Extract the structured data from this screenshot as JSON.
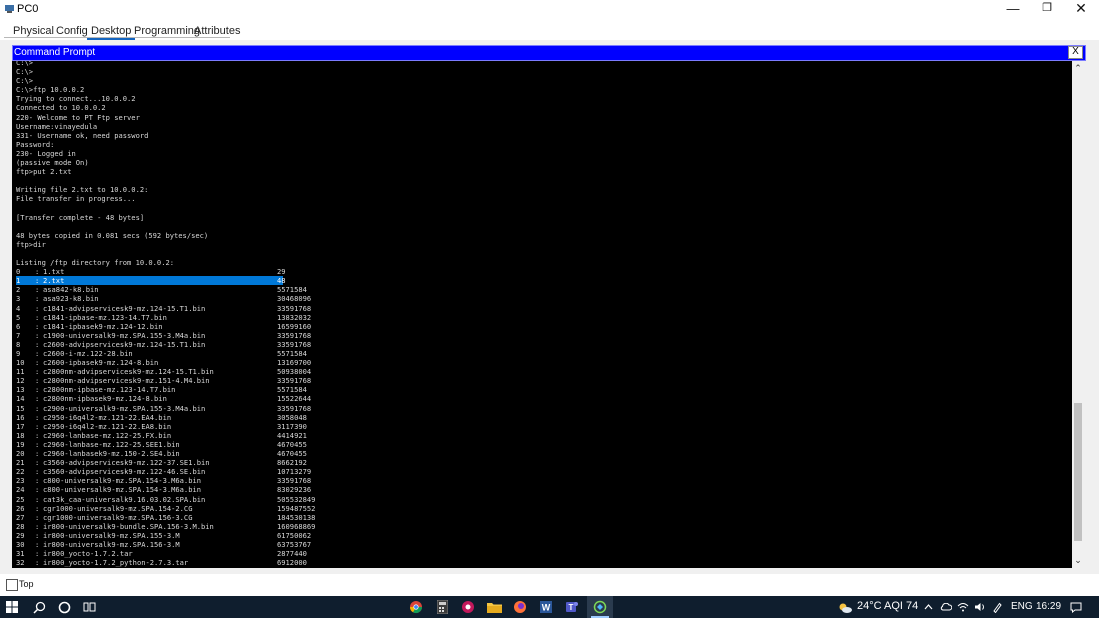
{
  "window": {
    "title": "PC0",
    "min_label": "—",
    "max_label": "❐",
    "close_label": "✕"
  },
  "tabs": [
    {
      "label": "Physical",
      "active": false
    },
    {
      "label": "Config",
      "active": false
    },
    {
      "label": "Desktop",
      "active": true
    },
    {
      "label": "Programming",
      "active": false
    },
    {
      "label": "Attributes",
      "active": false
    }
  ],
  "cmd": {
    "title": "Command Prompt",
    "close_label": "X",
    "header_lines": [
      "C:\\>",
      "C:\\>",
      "C:\\>",
      "C:\\>ftp 10.0.0.2",
      "Trying to connect...10.0.0.2",
      "Connected to 10.0.0.2",
      "220- Welcome to PT Ftp server",
      "Username:vinayedula",
      "331- Username ok, need password",
      "Password:",
      "230- Logged in",
      "(passive mode On)",
      "ftp>put 2.txt",
      "",
      "Writing file 2.txt to 10.0.0.2:",
      "File transfer in progress...",
      "",
      "[Transfer complete - 48 bytes]",
      "",
      "48 bytes copied in 0.081 secs (592 bytes/sec)",
      "ftp>dir",
      "",
      "Listing /ftp directory from 10.0.0.2:"
    ],
    "selected_index": 1,
    "listing": [
      {
        "num": "0",
        "sep": ":",
        "name": "1.txt",
        "size": "29"
      },
      {
        "num": "1",
        "sep": ":",
        "name": "2.txt",
        "size": "48"
      },
      {
        "num": "2",
        "sep": ":",
        "name": "asa842-k8.bin",
        "size": "5571584"
      },
      {
        "num": "3",
        "sep": ":",
        "name": "asa923-k8.bin",
        "size": "30468096"
      },
      {
        "num": "4",
        "sep": ":",
        "name": "c1841-advipservicesk9-mz.124-15.T1.bin",
        "size": "33591768"
      },
      {
        "num": "5",
        "sep": ":",
        "name": "c1841-ipbase-mz.123-14.T7.bin",
        "size": "13832032"
      },
      {
        "num": "6",
        "sep": ":",
        "name": "c1841-ipbasek9-mz.124-12.bin",
        "size": "16599160"
      },
      {
        "num": "7",
        "sep": ":",
        "name": "c1900-universalk9-mz.SPA.155-3.M4a.bin",
        "size": "33591768"
      },
      {
        "num": "8",
        "sep": ":",
        "name": "c2600-advipservicesk9-mz.124-15.T1.bin",
        "size": "33591768"
      },
      {
        "num": "9",
        "sep": ":",
        "name": "c2600-i-mz.122-28.bin",
        "size": "5571584"
      },
      {
        "num": "10",
        "sep": ":",
        "name": "c2600-ipbasek9-mz.124-8.bin",
        "size": "13169700"
      },
      {
        "num": "11",
        "sep": ":",
        "name": "c2800nm-advipservicesk9-mz.124-15.T1.bin",
        "size": "50938004"
      },
      {
        "num": "12",
        "sep": ":",
        "name": "c2800nm-advipservicesk9-mz.151-4.M4.bin",
        "size": "33591768"
      },
      {
        "num": "13",
        "sep": ":",
        "name": "c2800nm-ipbase-mz.123-14.T7.bin",
        "size": "5571584"
      },
      {
        "num": "14",
        "sep": ":",
        "name": "c2800nm-ipbasek9-mz.124-8.bin",
        "size": "15522644"
      },
      {
        "num": "15",
        "sep": ":",
        "name": "c2900-universalk9-mz.SPA.155-3.M4a.bin",
        "size": "33591768"
      },
      {
        "num": "16",
        "sep": ":",
        "name": "c2950-i6q4l2-mz.121-22.EA4.bin",
        "size": "3058048"
      },
      {
        "num": "17",
        "sep": ":",
        "name": "c2950-i6q4l2-mz.121-22.EA8.bin",
        "size": "3117390"
      },
      {
        "num": "18",
        "sep": ":",
        "name": "c2960-lanbase-mz.122-25.FX.bin",
        "size": "4414921"
      },
      {
        "num": "19",
        "sep": ":",
        "name": "c2960-lanbase-mz.122-25.SEE1.bin",
        "size": "4670455"
      },
      {
        "num": "20",
        "sep": ":",
        "name": "c2960-lanbasek9-mz.150-2.SE4.bin",
        "size": "4670455"
      },
      {
        "num": "21",
        "sep": ":",
        "name": "c3560-advipservicesk9-mz.122-37.SE1.bin",
        "size": "8662192"
      },
      {
        "num": "22",
        "sep": ":",
        "name": "c3560-advipservicesk9-mz.122-46.SE.bin",
        "size": "10713279"
      },
      {
        "num": "23",
        "sep": ":",
        "name": "c800-universalk9-mz.SPA.154-3.M6a.bin",
        "size": "33591768"
      },
      {
        "num": "24",
        "sep": ":",
        "name": "c800-universalk9-mz.SPA.154-3.M6a.bin",
        "size": "83029236"
      },
      {
        "num": "25",
        "sep": ":",
        "name": "cat3k_caa-universalk9.16.03.02.SPA.bin",
        "size": "505532849"
      },
      {
        "num": "26",
        "sep": ":",
        "name": "cgr1000-universalk9-mz.SPA.154-2.CG",
        "size": "159487552"
      },
      {
        "num": "27",
        "sep": ":",
        "name": "cgr1000-universalk9-mz.SPA.156-3.CG",
        "size": "184530138"
      },
      {
        "num": "28",
        "sep": ":",
        "name": "ir800-universalk9-bundle.SPA.156-3.M.bin",
        "size": "160968869"
      },
      {
        "num": "29",
        "sep": ":",
        "name": "ir800-universalk9-mz.SPA.155-3.M",
        "size": "61750062"
      },
      {
        "num": "30",
        "sep": ":",
        "name": "ir800-universalk9-mz.SPA.156-3.M",
        "size": "63753767"
      },
      {
        "num": "31",
        "sep": ":",
        "name": "ir800_yocto-1.7.2.tar",
        "size": "2877440"
      },
      {
        "num": "32",
        "sep": ":",
        "name": "ir800_yocto-1.7.2_python-2.7.3.tar",
        "size": "6912000"
      }
    ]
  },
  "footer": {
    "top_label": "Top"
  },
  "taskbar": {
    "apps": [
      {
        "name": "chrome",
        "icon": "chrome-icon"
      },
      {
        "name": "calculator",
        "icon": "calculator-icon"
      },
      {
        "name": "media",
        "icon": "media-player-icon"
      },
      {
        "name": "explorer",
        "icon": "file-explorer-icon"
      },
      {
        "name": "firefox",
        "icon": "firefox-icon"
      },
      {
        "name": "word",
        "icon": "word-icon"
      },
      {
        "name": "teams",
        "icon": "teams-icon"
      },
      {
        "name": "packet-tracer",
        "icon": "packet-tracer-icon"
      }
    ],
    "weather": "24°C AQI 74",
    "language": "ENG",
    "time": "16:29"
  },
  "colors": {
    "cmd_titlebar": "#0000ff",
    "selection": "#0078d7",
    "terminal_bg": "#000000",
    "terminal_text": "#d8d8d8",
    "taskbar_bg": "#0f1e2e"
  }
}
